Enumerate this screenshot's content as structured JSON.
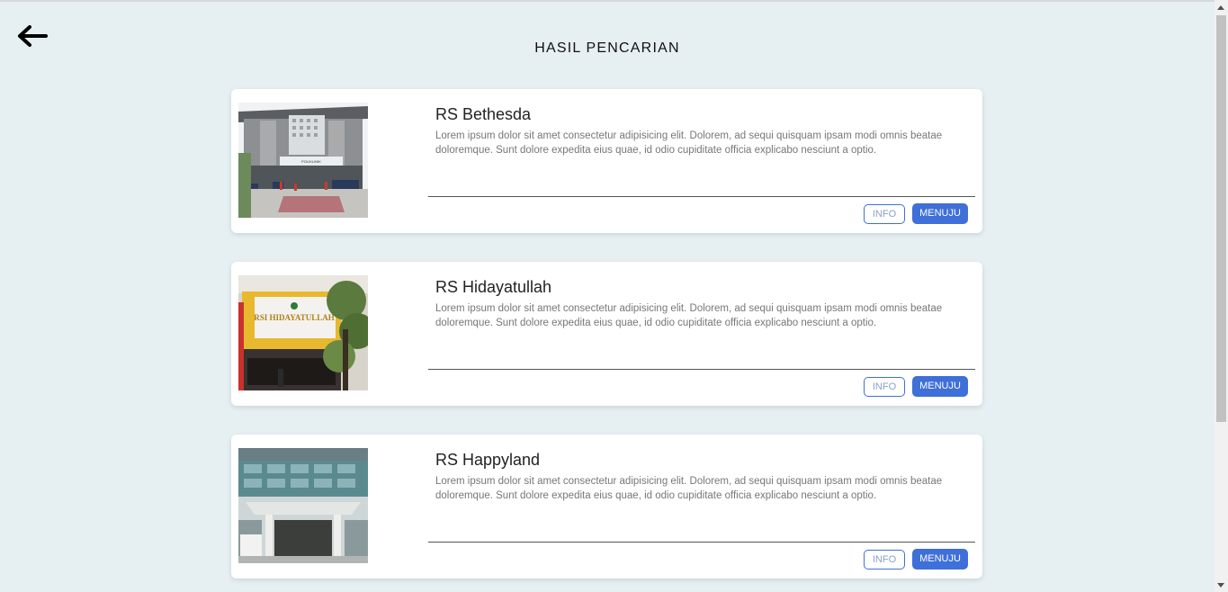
{
  "header": {
    "title": "HASIL PENCARIAN",
    "back_icon": "arrow-left-icon"
  },
  "results": [
    {
      "name": "RS Bethesda",
      "description": "Lorem ipsum dolor sit amet consectetur adipisicing elit. Dolorem, ad sequi quisquam ipsam modi omnis beatae doloremque. Sunt dolore expedita eius quae, id odio cupiditate officia explicabo nesciunt a optio.",
      "image_sign_text": "POLIKLINIK",
      "info_label": "INFO",
      "go_label": "MENUJU"
    },
    {
      "name": "RS Hidayatullah",
      "description": "Lorem ipsum dolor sit amet consectetur adipisicing elit. Dolorem, ad sequi quisquam ipsam modi omnis beatae doloremque. Sunt dolore expedita eius quae, id odio cupiditate officia explicabo nesciunt a optio.",
      "image_sign_text": "RSI HIDAYATULLAH",
      "info_label": "INFO",
      "go_label": "MENUJU"
    },
    {
      "name": "RS Happyland",
      "description": "Lorem ipsum dolor sit amet consectetur adipisicing elit. Dolorem, ad sequi quisquam ipsam modi omnis beatae doloremque. Sunt dolore expedita eius quae, id odio cupiditate officia explicabo nesciunt a optio.",
      "image_sign_text": "",
      "info_label": "INFO",
      "go_label": "MENUJU"
    }
  ],
  "colors": {
    "background": "#e6f0f2",
    "accent": "#3f6fd8",
    "card": "#ffffff"
  }
}
